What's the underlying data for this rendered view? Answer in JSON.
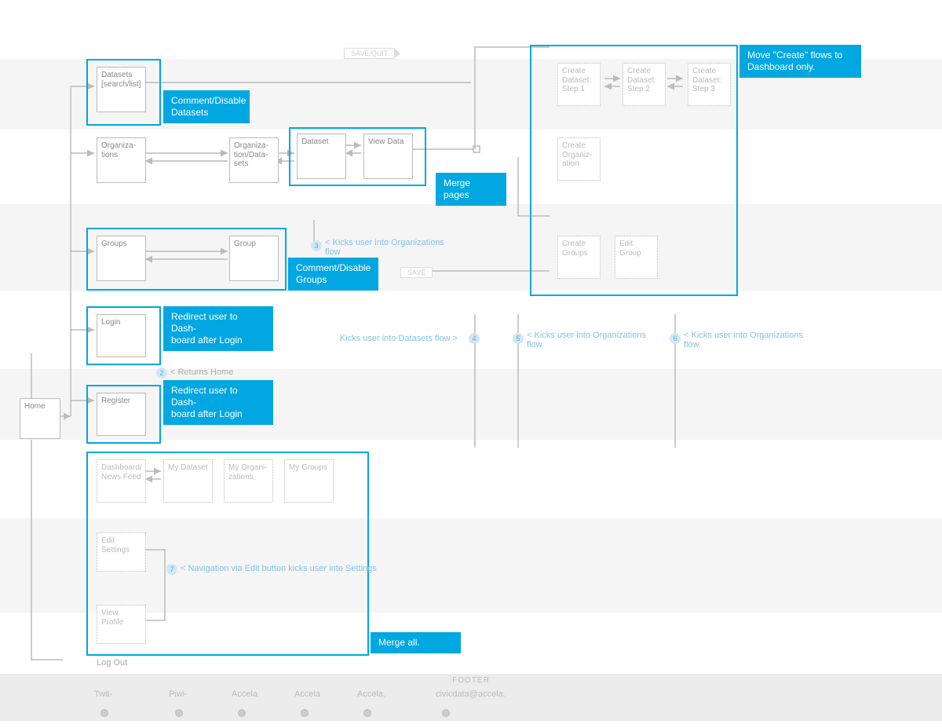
{
  "nodes": {
    "home": "Home",
    "datasets": "Datasets [search/list]",
    "organizations": "Organiza-\ntions",
    "orgDatasets": "Organiza-\ntion/Data-\nsets",
    "dataset": "Dataset",
    "viewData": "View Data",
    "groups": "Groups",
    "group": "Group",
    "login": "Login",
    "register": "Register",
    "dashboard": "Dashboard/\nNews Feed",
    "myDataset": "My Dataset",
    "myOrgs": "My Organi-\nzations",
    "myGroups": "My Groups",
    "editSettings": "Edit Settings",
    "viewProfile": "View Profile",
    "createDs1": "Create\nDataset:\nStep 1",
    "createDs2": "Create\nDataset:\nStep 2",
    "createDs3": "Create\nDataset:\nStep 3",
    "createOrg": "Create\nOrganiz-\nation",
    "createGroups": "Create\nGroups",
    "editGroup": "Edit Group",
    "logOut": "Log Out"
  },
  "notes": {
    "commentDatasets": "Comment/Disable Datasets",
    "commentGroups": "Comment/Disable Groups",
    "mergePages": "Merge pages",
    "redirect1": "Redirect user to Dash-\nboard after Login",
    "redirect2": "Redirect user to Dash-\nboard after Login",
    "mergeAll": "Merge all.",
    "moveCreate": "Move \"Create\" flows to Dashboard only."
  },
  "annotations": {
    "kicksOrg1": "< Kicks user into Organizations flow",
    "kicksDs": "Kicks user into Datasets flow >",
    "kicksOrg2": "< Kicks user into Organizations flow",
    "kicksOrg3": "< Kicks user into Organizations flow",
    "navSettings": "< Navigation via Edit button kicks user into Settings",
    "returnsHome": "< Returns Home"
  },
  "tags": {
    "saveQuit": "SAVE/QUIT",
    "save": "SAVE"
  },
  "footer": {
    "title": "FOOTER",
    "links": [
      "Twit-",
      "Piwi-",
      "Accela",
      "Accela",
      "Accela.",
      "civicdata@accela."
    ]
  }
}
